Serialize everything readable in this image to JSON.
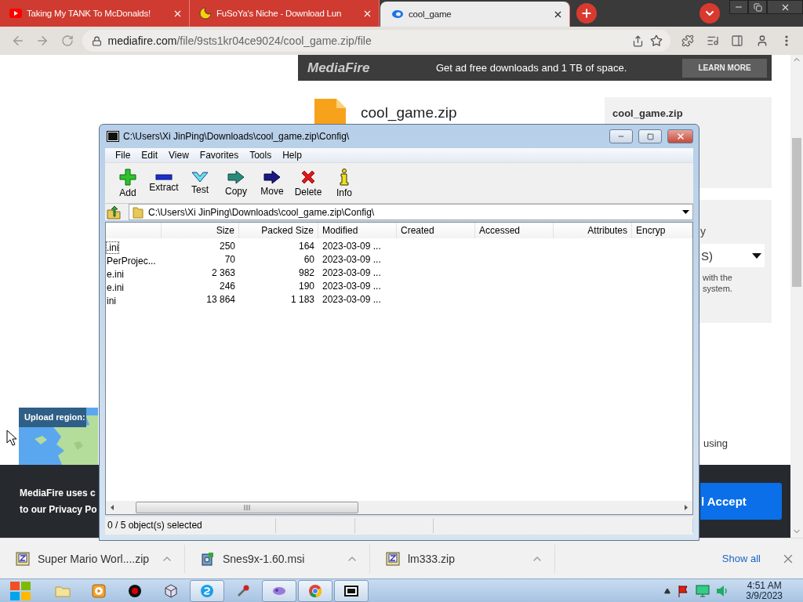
{
  "browser": {
    "tabs": [
      {
        "title": "Taking My TANK To McDonalds!",
        "selected": false
      },
      {
        "title": "FuSoYa's Niche - Download Lun",
        "selected": false
      },
      {
        "title": "cool_game",
        "selected": true
      }
    ],
    "address": {
      "host": "mediafire.com",
      "path": "/file/9sts1kr04ce9024/cool_game.zip/file"
    }
  },
  "page": {
    "banner": {
      "logo": "MediaFire",
      "text": "Get ad free downloads and 1 TB of space.",
      "button": "LEARN MORE"
    },
    "file_name": "cool_game.zip",
    "info_panel": {
      "title": "cool_game.zip"
    },
    "options_panel": {
      "label": "y",
      "dropdown": "S)",
      "note_lines": [
        "with the",
        "system."
      ]
    },
    "upload_region": "Upload region:",
    "side_text": "using",
    "cookie_notice": {
      "lines": [
        "MediaFire uses c",
        "to our Privacy Po"
      ],
      "button": "l Accept"
    }
  },
  "archive_window": {
    "title": "C:\\Users\\Xi JinPing\\Downloads\\cool_game.zip\\Config\\",
    "menu": [
      "File",
      "Edit",
      "View",
      "Favorites",
      "Tools",
      "Help"
    ],
    "toolbar": [
      "Add",
      "Extract",
      "Test",
      "Copy",
      "Move",
      "Delete",
      "Info"
    ],
    "path": "C:\\Users\\Xi JinPing\\Downloads\\cool_game.zip\\Config\\",
    "columns": [
      "",
      "Size",
      "Packed Size",
      "Modified",
      "Created",
      "Accessed",
      "Attributes",
      "Encryp"
    ],
    "rows": [
      {
        "cells": [
          ".ini",
          "250",
          "164",
          "2023-03-09 ..."
        ],
        "focused": true
      },
      {
        "cells": [
          "PerProjec...",
          "70",
          "60",
          "2023-03-09 ..."
        ],
        "focused": false
      },
      {
        "cells": [
          "e.ini",
          "2 363",
          "982",
          "2023-03-09 ..."
        ],
        "focused": false
      },
      {
        "cells": [
          "e.ini",
          "246",
          "190",
          "2023-03-09 ..."
        ],
        "focused": false
      },
      {
        "cells": [
          "ini",
          "13 864",
          "1 183",
          "2023-03-09 ..."
        ],
        "focused": false
      }
    ],
    "status": "0 / 5 object(s) selected"
  },
  "downloads": {
    "items": [
      "Super Mario Worl....zip",
      "Snes9x-1.60.msi",
      "lm333.zip"
    ],
    "show_all": "Show all"
  },
  "taskbar": {
    "apps": [
      {
        "active": false
      },
      {
        "active": false
      },
      {
        "active": false
      },
      {
        "active": false
      },
      {
        "active": true
      },
      {
        "active": false
      },
      {
        "active": true
      },
      {
        "active": true
      },
      {
        "active": true
      }
    ],
    "time": "4:51 AM",
    "date": "3/9/2023"
  }
}
